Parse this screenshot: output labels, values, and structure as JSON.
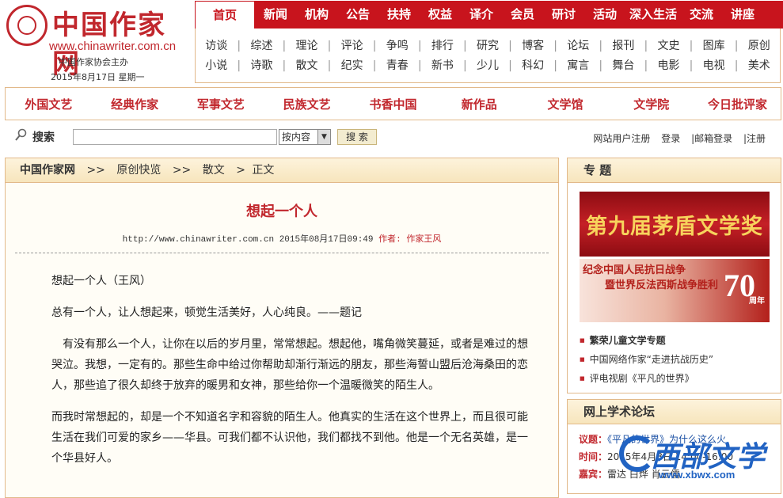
{
  "logo": {
    "title": "中国作家网",
    "url": "www.chinawriter.com.cn",
    "host": "中国作家协会主办",
    "date": "2015年8月17日  星期一"
  },
  "topnav": {
    "items": [
      {
        "label": "首页",
        "active": true
      },
      {
        "label": "新闻"
      },
      {
        "label": "机构"
      },
      {
        "label": "公告"
      },
      {
        "label": "扶持"
      },
      {
        "label": "权益"
      },
      {
        "label": "译介"
      },
      {
        "label": "会员"
      },
      {
        "label": "研讨"
      },
      {
        "label": "活动"
      },
      {
        "label": "深入生活"
      },
      {
        "label": "交流"
      },
      {
        "label": "讲座"
      }
    ]
  },
  "subnav": {
    "row1": [
      "访谈",
      "综述",
      "理论",
      "评论",
      "争鸣",
      "排行",
      "研究",
      "博客",
      "论坛",
      "报刊",
      "文史",
      "图库",
      "原创"
    ],
    "row2": [
      "小说",
      "诗歌",
      "散文",
      "纪实",
      "青春",
      "新书",
      "少儿",
      "科幻",
      "寓言",
      "舞台",
      "电影",
      "电视",
      "美术"
    ]
  },
  "channels": [
    "外国文艺",
    "经典作家",
    "军事文艺",
    "民族文艺",
    "书香中国",
    "新作品",
    "文学馆",
    "文学院",
    "今日批评家"
  ],
  "search": {
    "label": "搜索",
    "input_value": "",
    "select_value": "按内容",
    "button": "搜 索"
  },
  "user_links": [
    "网站用户注册",
    "登录",
    "|邮箱登录",
    "|注册"
  ],
  "breadcrumb": {
    "items": [
      "中国作家网",
      "原创快览",
      "散文",
      "正文"
    ],
    "sep": ">>",
    "last_sep": ">"
  },
  "article": {
    "title": "想起一个人",
    "meta_url": "http://www.chinawriter.com.cn 2015年08月17日09:49",
    "meta_author": "作者: 作家王风",
    "paragraphs": [
      "想起一个人（王风）",
      "总有一个人，让人想起来，顿觉生活美好，人心纯良。——题记",
      "　有没有那么一个人，让你在以后的岁月里，常常想起。想起他，嘴角微笑蔓延，或者是难过的想哭泣。我想，一定有的。那些生命中给过你帮助却渐行渐远的朋友，那些海誓山盟后沧海桑田的恋人，那些追了很久却终于放弃的暖男和女神，那些给你一个温暖微笑的陌生人。",
      "而我时常想起的，却是一个不知道名字和容貌的陌生人。他真实的生活在这个世界上，而且很可能生活在我们可爱的家乡——华县。可我们都不认识他，我们都找不到他。他是一个无名英雄，是一个华县好人。"
    ]
  },
  "topic_box": {
    "title": "专 题",
    "banner1": "第九届茅盾文学奖",
    "banner2_line1": "纪念中国人民抗日战争",
    "banner2_line2": "暨世界反法西斯战争胜利",
    "banner2_num": "70",
    "banner2_suffix": "周年",
    "links": [
      {
        "text": "繁荣儿童文学专题",
        "bold": true
      },
      {
        "text": "中国网络作家“走进抗战历史”"
      },
      {
        "text": "评电视剧《平凡的世界》"
      }
    ]
  },
  "forum_box": {
    "title": "网上学术论坛",
    "rows": [
      {
        "label": "议题：",
        "value": "《平凡的世界》为什么这么火"
      },
      {
        "label": "时间：",
        "value": "2015年4月8日  14:00-16:00"
      },
      {
        "label": "嘉宾：",
        "value": "雷达 白烨 肖云儒"
      }
    ]
  },
  "watermark": {
    "text": "西部文学",
    "url": "www.xbwx.com"
  },
  "colors": {
    "brand_red": "#c8141d",
    "panel_border": "#e2b98a",
    "watermark_blue": "#2163c3"
  }
}
